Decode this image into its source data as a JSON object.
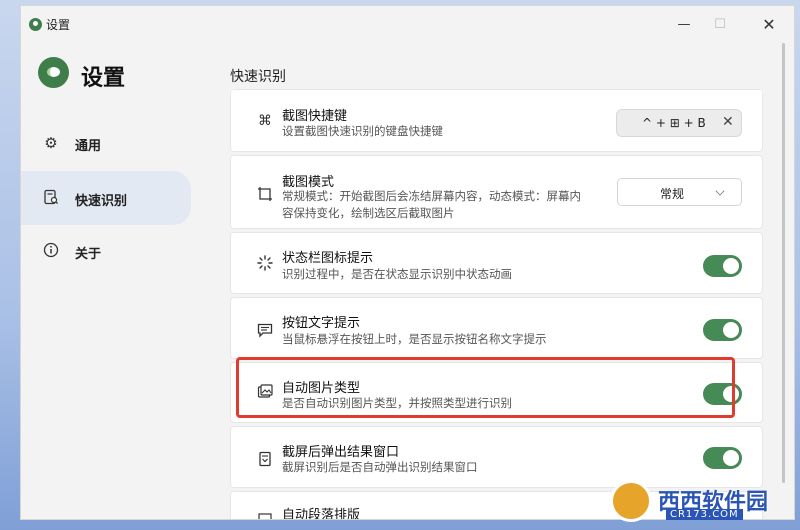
{
  "window": {
    "title": "设置",
    "controls": {
      "minimize": "—",
      "maximize": "☐",
      "close": "✕"
    }
  },
  "brand": {
    "title": "设置",
    "color": "#3f7d4a"
  },
  "sidebar": {
    "items": [
      {
        "label": "通用",
        "icon": "gear-icon",
        "active": false
      },
      {
        "label": "快速识别",
        "icon": "scan-document-icon",
        "active": true
      },
      {
        "label": "关于",
        "icon": "info-icon",
        "active": false
      }
    ]
  },
  "section": {
    "title": "快速识别"
  },
  "rows": [
    {
      "title": "截图快捷键",
      "desc": "设置截图快速识别的键盘快捷键",
      "icon": "command-key-icon",
      "control": "shortcut",
      "shortcut": "^ + ⊞ + B",
      "clear": "✕"
    },
    {
      "title": "截图模式",
      "desc1": "常规模式：开始截图后会冻结屏幕内容，动态模式：屏幕内",
      "desc2": "容保持变化，绘制选区后截取图片",
      "icon": "screenshot-frame-icon",
      "control": "select",
      "value": "常规"
    },
    {
      "title": "状态栏图标提示",
      "desc": "识别过程中，是否在状态显示识别中状态动画",
      "icon": "loading-spinner-icon",
      "control": "toggle",
      "on": true
    },
    {
      "title": "按钮文字提示",
      "desc": "当鼠标悬浮在按钮上时，是否显示按钮名称文字提示",
      "icon": "message-icon",
      "control": "toggle",
      "on": true
    },
    {
      "title": "自动图片类型",
      "desc": "是否自动识别图片类型，并按照类型进行识别",
      "icon": "image-type-icon",
      "control": "toggle",
      "on": true
    },
    {
      "title": "截屏后弹出结果窗口",
      "desc": "截屏识别后是否自动弹出识别结果窗口",
      "icon": "result-window-icon",
      "control": "toggle",
      "on": true
    },
    {
      "title": "自动段落排版",
      "icon": "paragraph-layout-icon",
      "control": "none"
    }
  ],
  "colors": {
    "accent": "#468a55",
    "highlight": "#e13b2e",
    "active_nav": "#e3e9f3"
  },
  "watermark": {
    "text": "西西软件园",
    "sub": "CR173.COM"
  }
}
